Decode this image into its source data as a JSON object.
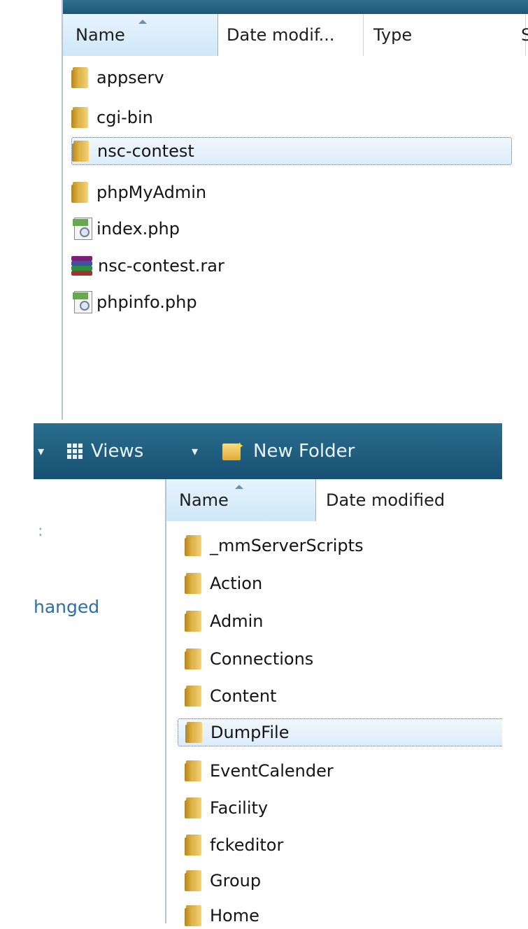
{
  "top_window": {
    "columns": [
      "Name",
      "Date modif...",
      "Type",
      "S"
    ],
    "files": [
      {
        "name": "appserv",
        "icon": "folder-icon"
      },
      {
        "name": "cgi-bin",
        "icon": "folder-icon"
      },
      {
        "name": "nsc-contest",
        "icon": "folder-icon",
        "selected": true
      },
      {
        "name": "phpMyAdmin",
        "icon": "folder-icon"
      },
      {
        "name": "index.php",
        "icon": "php-file-icon"
      },
      {
        "name": "nsc-contest.rar",
        "icon": "rar-archive-icon"
      },
      {
        "name": "phpinfo.php",
        "icon": "php-file-icon"
      }
    ]
  },
  "bottom_window": {
    "toolbar": {
      "views_label": "Views",
      "new_folder_label": "New Folder"
    },
    "left_pane": {
      "fragment_1": ":",
      "link_fragment": "hanged"
    },
    "columns": [
      "Name",
      "Date modified"
    ],
    "files": [
      {
        "name": "_mmServerScripts"
      },
      {
        "name": "Action"
      },
      {
        "name": "Admin"
      },
      {
        "name": "Connections"
      },
      {
        "name": "Content"
      },
      {
        "name": "DumpFile",
        "selected": true
      },
      {
        "name": "EventCalender"
      },
      {
        "name": "Facility"
      },
      {
        "name": "fckeditor"
      },
      {
        "name": "Group"
      },
      {
        "name": "Home"
      }
    ]
  },
  "colors": {
    "toolbar": "#1f5b7d",
    "selection": "#dcecfb",
    "link": "#2d6ea6"
  }
}
